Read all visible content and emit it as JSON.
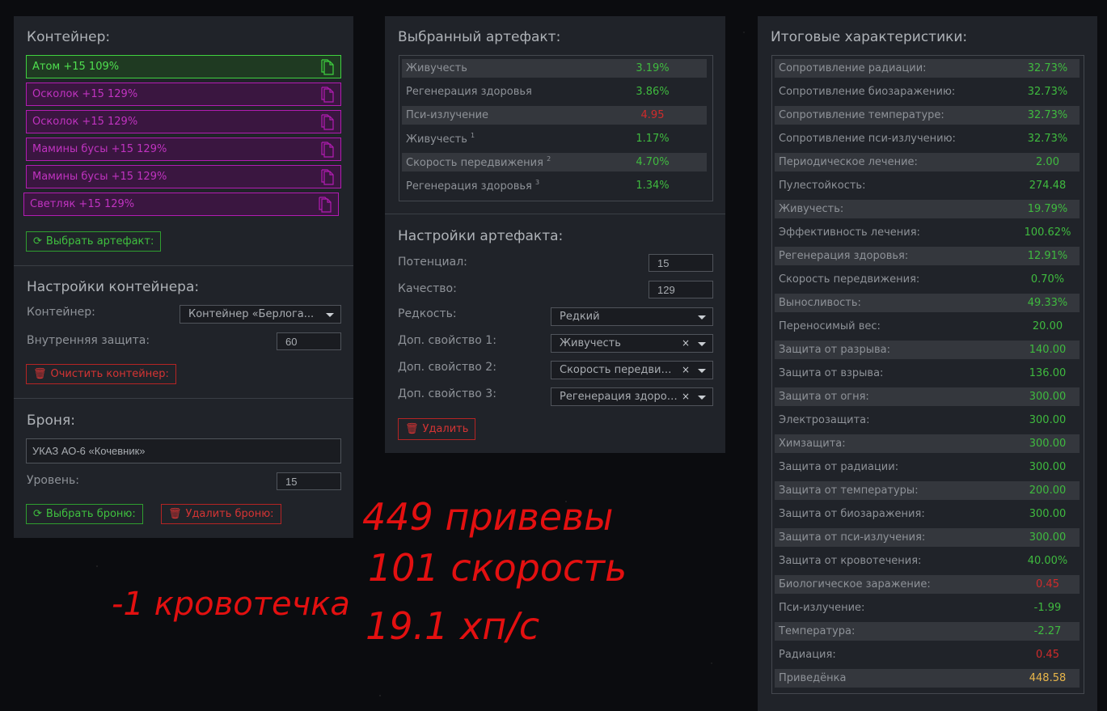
{
  "container": {
    "title": "Контейнер:",
    "items": [
      {
        "label": "Атом +15 109%",
        "style": "green"
      },
      {
        "label": "Осколок +15 129%",
        "style": "purple"
      },
      {
        "label": "Осколок +15 129%",
        "style": "purple"
      },
      {
        "label": "Мамины бусы +15 129%",
        "style": "purple"
      },
      {
        "label": "Мамины бусы +15 129%",
        "style": "purple"
      },
      {
        "label": "Светляк +15 129%",
        "style": "purple"
      }
    ],
    "select_button": "Выбрать артефакт:"
  },
  "container_settings": {
    "title": "Настройки контейнера:",
    "container_label": "Контейнер:",
    "container_value": "Контейнер «Берлога...",
    "protection_label": "Внутренняя защита:",
    "protection_value": "60",
    "clear_button": "Очистить контейнер:"
  },
  "armor": {
    "title": "Броня:",
    "name": "УКАЗ АО-6 «Кочевник»",
    "level_label": "Уровень:",
    "level_value": "15",
    "select_button": "Выбрать броню:",
    "delete_button": "Удалить броню:"
  },
  "selected_artifact": {
    "title": "Выбранный артефакт:",
    "stats": [
      {
        "name": "Живучесть",
        "sup": "",
        "value": "3.19%",
        "color": "g"
      },
      {
        "name": "Регенерация здоровья",
        "sup": "",
        "value": "3.86%",
        "color": "g"
      },
      {
        "name": "Пси-излучение",
        "sup": "",
        "value": "4.95",
        "color": "r"
      },
      {
        "name": "Живучесть",
        "sup": "1",
        "value": "1.17%",
        "color": "g"
      },
      {
        "name": "Скорость передвижения",
        "sup": "2",
        "value": "4.70%",
        "color": "g"
      },
      {
        "name": "Регенерация здоровья",
        "sup": "3",
        "value": "1.34%",
        "color": "g"
      }
    ]
  },
  "artifact_settings": {
    "title": "Настройки артефакта:",
    "potential_label": "Потенциал:",
    "potential_value": "15",
    "quality_label": "Качество:",
    "quality_value": "129",
    "rarity_label": "Редкость:",
    "rarity_value": "Редкий",
    "prop1_label": "Доп. свойство 1:",
    "prop1_value": "Живучесть",
    "prop2_label": "Доп. свойство 2:",
    "prop2_value": "Скорость передвижения",
    "prop3_label": "Доп. свойство 3:",
    "prop3_value": "Регенерация здоровья",
    "clear_symbol": "×",
    "delete_button": "Удалить"
  },
  "totals": {
    "title": "Итоговые характеристики:",
    "stats": [
      {
        "name": "Сопротивление радиации:",
        "value": "32.73%",
        "color": "g"
      },
      {
        "name": "Сопротивление биозаражению:",
        "value": "32.73%",
        "color": "g"
      },
      {
        "name": "Сопротивление температуре:",
        "value": "32.73%",
        "color": "g"
      },
      {
        "name": "Сопротивление пси-излучению:",
        "value": "32.73%",
        "color": "g"
      },
      {
        "name": "Периодическое лечение:",
        "value": "2.00",
        "color": "g"
      },
      {
        "name": "Пулестойкость:",
        "value": "274.48",
        "color": "g"
      },
      {
        "name": "Живучесть:",
        "value": "19.79%",
        "color": "g"
      },
      {
        "name": "Эффективность лечения:",
        "value": "100.62%",
        "color": "g"
      },
      {
        "name": "Регенерация здоровья:",
        "value": "12.91%",
        "color": "g"
      },
      {
        "name": "Скорость передвижения:",
        "value": "0.70%",
        "color": "g"
      },
      {
        "name": "Выносливость:",
        "value": "49.33%",
        "color": "g"
      },
      {
        "name": "Переносимый вес:",
        "value": "20.00",
        "color": "g"
      },
      {
        "name": "Защита от разрыва:",
        "value": "140.00",
        "color": "g"
      },
      {
        "name": "Защита от взрыва:",
        "value": "136.00",
        "color": "g"
      },
      {
        "name": "Защита от огня:",
        "value": "300.00",
        "color": "g"
      },
      {
        "name": "Электрозащита:",
        "value": "300.00",
        "color": "g"
      },
      {
        "name": "Химзащита:",
        "value": "300.00",
        "color": "g"
      },
      {
        "name": "Защита от радиации:",
        "value": "300.00",
        "color": "g"
      },
      {
        "name": "Защита от температуры:",
        "value": "200.00",
        "color": "g"
      },
      {
        "name": "Защита от биозаражения:",
        "value": "300.00",
        "color": "g"
      },
      {
        "name": "Защита от пси-излучения:",
        "value": "300.00",
        "color": "g"
      },
      {
        "name": "Защита от кровотечения:",
        "value": "40.00%",
        "color": "g"
      },
      {
        "name": "Биологическое заражение:",
        "value": "0.45",
        "color": "r"
      },
      {
        "name": "Пси-излучение:",
        "value": "-1.99",
        "color": "g"
      },
      {
        "name": "Температура:",
        "value": "-2.27",
        "color": "g"
      },
      {
        "name": "Радиация:",
        "value": "0.45",
        "color": "r"
      },
      {
        "name": "Приведёнка",
        "value": "448.58",
        "color": "y"
      }
    ]
  },
  "handwritten": {
    "line1": "449 привевы",
    "line2": "101 скорость",
    "line3": "19.1 хп/с",
    "line4": "-1 кровотечка"
  },
  "colors": {
    "accent_green": "#3fba3f",
    "accent_red": "#d02b2b",
    "accent_purple": "#b21cb2",
    "handwriting": "#e31010"
  }
}
